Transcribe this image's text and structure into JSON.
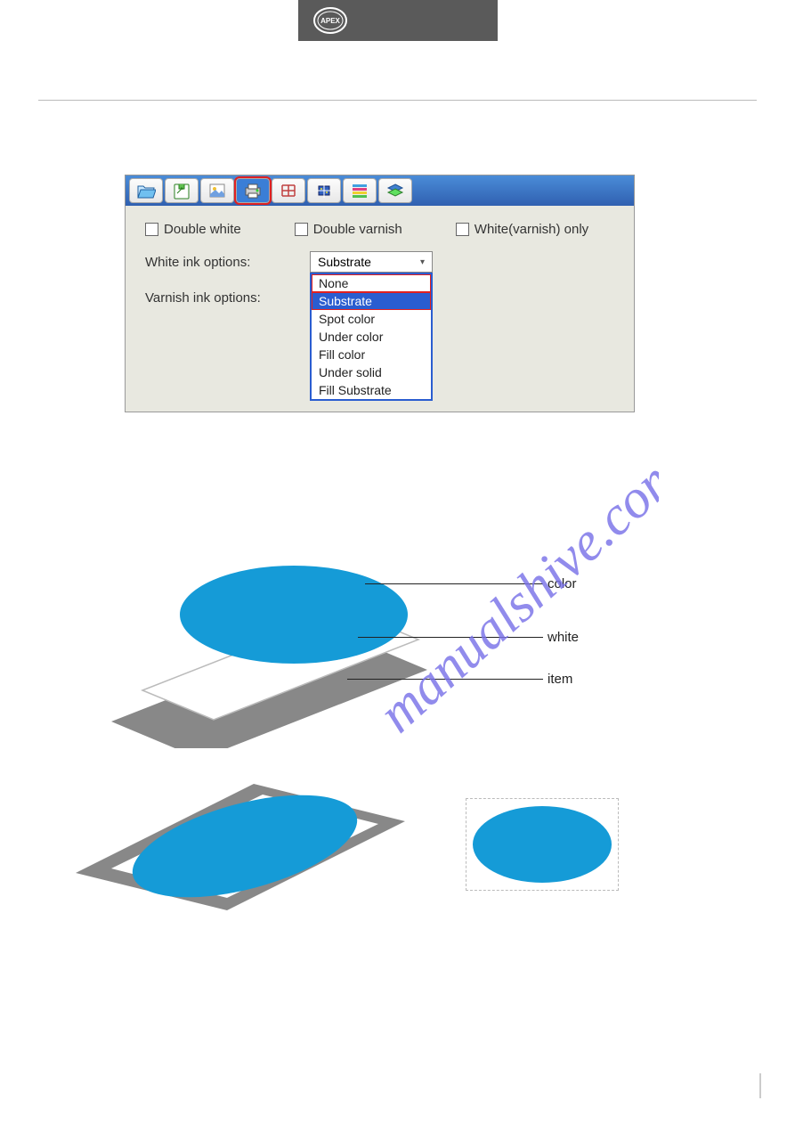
{
  "logo_name": "APEX",
  "toolbar": {
    "buttons": [
      "file-open",
      "file-save",
      "image-settings",
      "print-options",
      "grid-view",
      "align",
      "color-bars",
      "layers"
    ]
  },
  "checkboxes": {
    "double_white": "Double white",
    "double_varnish": "Double varnish",
    "white_varnish_only": "White(varnish) only"
  },
  "labels": {
    "white_ink_options": "White ink options:",
    "varnish_ink_options": "Varnish ink options:"
  },
  "dropdown": {
    "selected": "Substrate",
    "options": [
      "None",
      "Substrate",
      "Spot color",
      "Under color",
      "Fill color",
      "Under solid",
      "Fill Substrate"
    ]
  },
  "diagram_labels": {
    "color": "color",
    "white": "white",
    "item": "item"
  },
  "watermark_text": "manualshive.com"
}
